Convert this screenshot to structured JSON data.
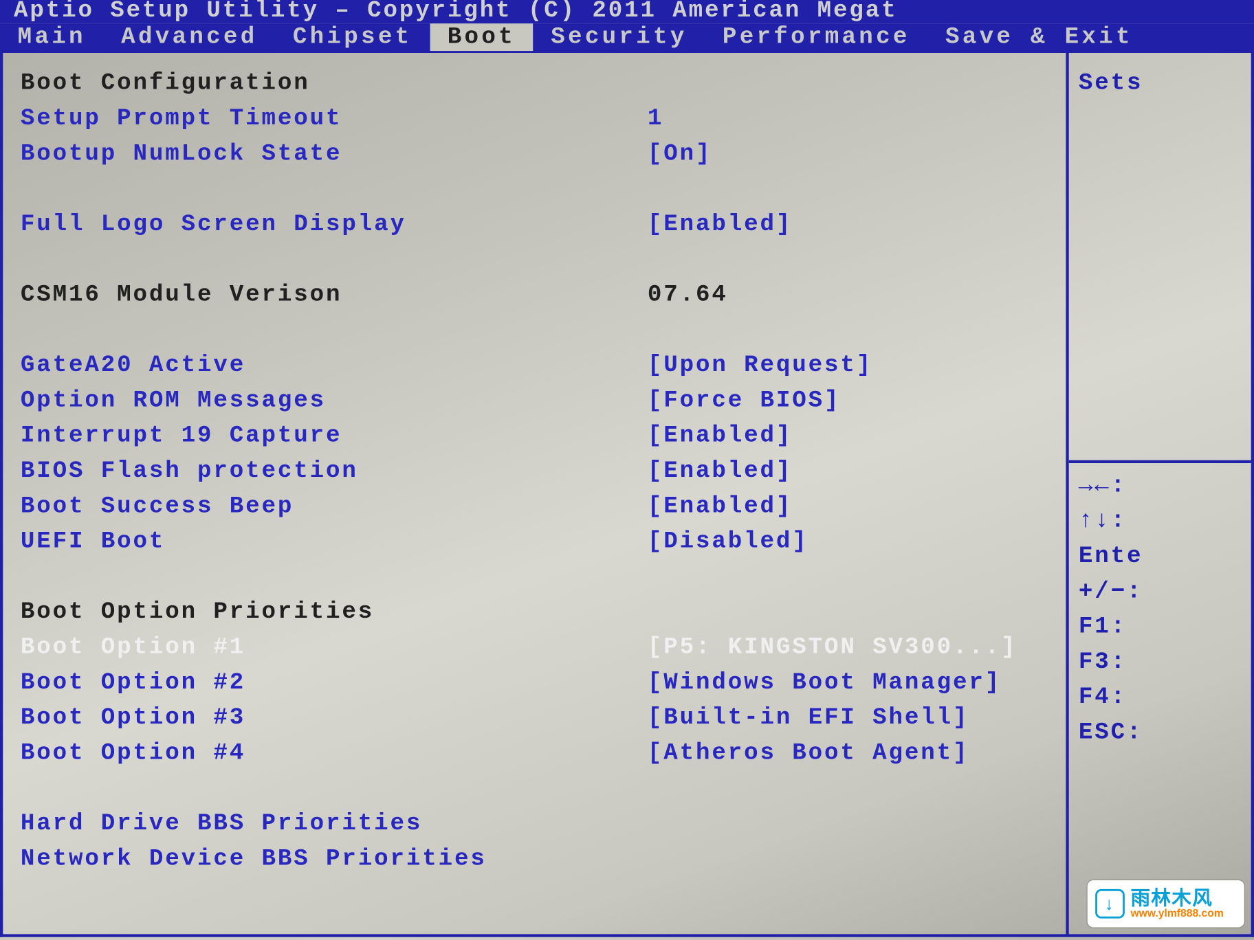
{
  "header": {
    "title": "Aptio Setup Utility – Copyright (C) 2011 American Megat"
  },
  "menu": {
    "items": [
      "Main",
      "Advanced",
      "Chipset",
      "Boot",
      "Security",
      "Performance",
      "Save & Exit"
    ],
    "active_index": 3
  },
  "sections": {
    "boot_config_title": "Boot Configuration",
    "setup_prompt": {
      "label": "Setup Prompt Timeout",
      "value": "1"
    },
    "numlock": {
      "label": "Bootup NumLock State",
      "value": "[On]"
    },
    "full_logo": {
      "label": "Full Logo Screen Display",
      "value": "[Enabled]"
    },
    "csm16": {
      "label": "CSM16 Module Verison",
      "value": "07.64"
    },
    "gatea20": {
      "label": "GateA20 Active",
      "value": "[Upon Request]"
    },
    "optrom": {
      "label": "Option ROM Messages",
      "value": "[Force BIOS]"
    },
    "int19": {
      "label": "Interrupt 19 Capture",
      "value": "[Enabled]"
    },
    "flashprot": {
      "label": "BIOS Flash protection",
      "value": "[Enabled]"
    },
    "beep": {
      "label": "Boot Success Beep",
      "value": "[Enabled]"
    },
    "uefi": {
      "label": "UEFI Boot",
      "value": "[Disabled]"
    },
    "priorities_title": "Boot Option Priorities",
    "boot1": {
      "label": "Boot Option #1",
      "value": "[P5: KINGSTON SV300...]"
    },
    "boot2": {
      "label": "Boot Option #2",
      "value": "[Windows Boot Manager]"
    },
    "boot3": {
      "label": "Boot Option #3",
      "value": "[Built-in EFI Shell]"
    },
    "boot4": {
      "label": "Boot Option #4",
      "value": "[Atheros Boot Agent]"
    },
    "hdd_bbs": "Hard Drive BBS Priorities",
    "net_bbs": "Network Device BBS Priorities"
  },
  "side": {
    "help_top": "Sets",
    "keys": {
      "lr": "→←:",
      "ud": "↑↓:",
      "enter": "Ente",
      "pm": "+/−:",
      "f1": "F1:",
      "f3": "F3:",
      "f4": "F4:",
      "esc": "ESC:"
    }
  },
  "watermark": {
    "icon_char": "↓",
    "cn": "雨林木风",
    "url": "www.ylmf888.com"
  }
}
